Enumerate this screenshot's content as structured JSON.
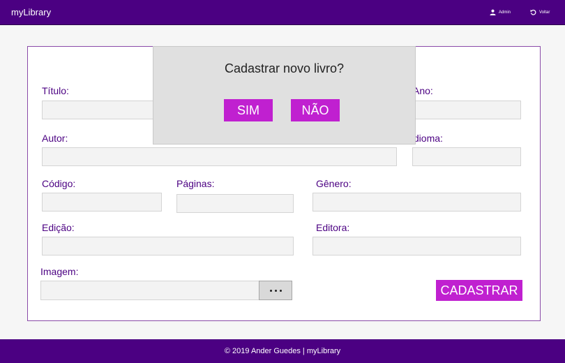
{
  "header": {
    "brand": "myLibrary",
    "admin_label": "Admin",
    "back_label": "Voltar"
  },
  "form": {
    "titulo_label": "Título:",
    "ano_label": "Ano:",
    "autor_label": "Autor:",
    "idioma_label": "Idioma:",
    "codigo_label": "Código:",
    "paginas_label": "Páginas:",
    "genero_label": "Gênero:",
    "edicao_label": "Edição:",
    "editora_label": "Editora:",
    "imagem_label": "Imagem:",
    "submit_label": "CADASTRAR"
  },
  "modal": {
    "title": "Cadastrar novo livro?",
    "yes_label": "SIM",
    "no_label": "NÃO"
  },
  "footer": {
    "text": "© 2019 Ander Guedes | myLibrary"
  },
  "colors": {
    "primary": "#4b0082",
    "accent": "#c020d0"
  }
}
